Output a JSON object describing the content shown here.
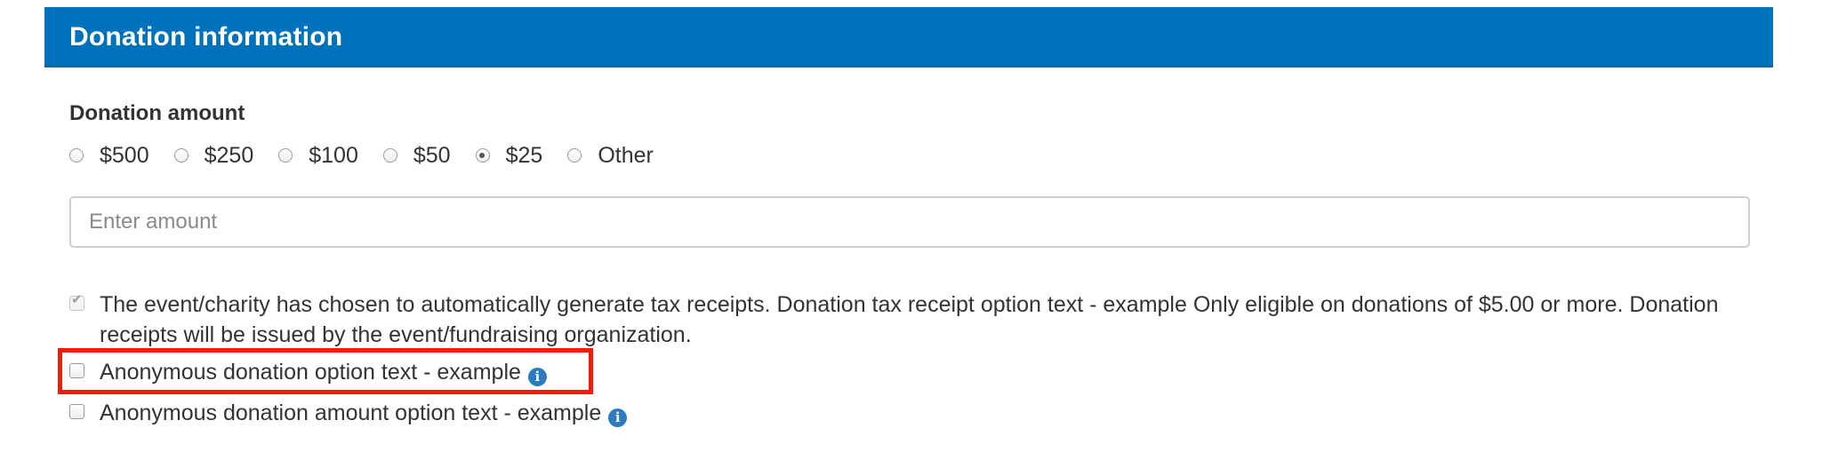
{
  "section": {
    "title": "Donation information"
  },
  "donation_amount": {
    "label": "Donation amount",
    "options": [
      {
        "label": "$500",
        "selected": false
      },
      {
        "label": "$250",
        "selected": false
      },
      {
        "label": "$100",
        "selected": false
      },
      {
        "label": "$50",
        "selected": false
      },
      {
        "label": "$25",
        "selected": true
      },
      {
        "label": "Other",
        "selected": false
      }
    ],
    "selected_value": "$25",
    "amount_input": {
      "placeholder": "Enter amount",
      "value": ""
    }
  },
  "tax_receipt": {
    "checked": true,
    "disabled": true,
    "text": "The event/charity has chosen to automatically generate tax receipts. Donation tax receipt option text - example Only eligible on donations of $5.00 or more. Donation receipts will be issued by the event/fundraising organization."
  },
  "anonymous_donation": {
    "checked": false,
    "text": "Anonymous donation option text - example",
    "info_icon": "info-icon",
    "info_glyph": "i"
  },
  "anonymous_amount": {
    "checked": false,
    "text": "Anonymous donation amount option text - example",
    "info_icon": "info-icon",
    "info_glyph": "i"
  },
  "colors": {
    "header_bg": "#0072bc",
    "info_icon": "#2a7bbf",
    "highlight": "#f21b0c"
  }
}
